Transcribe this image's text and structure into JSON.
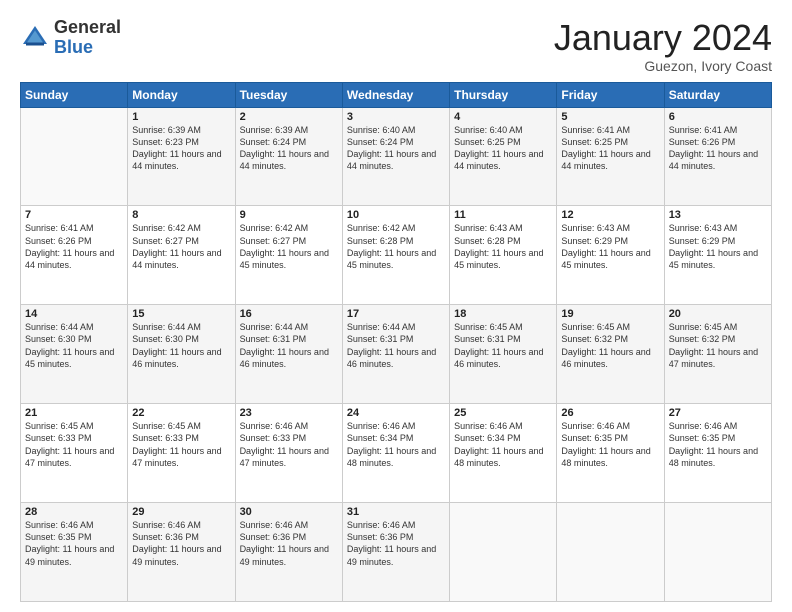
{
  "header": {
    "logo_general": "General",
    "logo_blue": "Blue",
    "month_title": "January 2024",
    "location": "Guezon, Ivory Coast"
  },
  "weekdays": [
    "Sunday",
    "Monday",
    "Tuesday",
    "Wednesday",
    "Thursday",
    "Friday",
    "Saturday"
  ],
  "weeks": [
    [
      {
        "day": "",
        "sunrise": "",
        "sunset": "",
        "daylight": ""
      },
      {
        "day": "1",
        "sunrise": "6:39 AM",
        "sunset": "6:23 PM",
        "daylight": "11 hours and 44 minutes."
      },
      {
        "day": "2",
        "sunrise": "6:39 AM",
        "sunset": "6:24 PM",
        "daylight": "11 hours and 44 minutes."
      },
      {
        "day": "3",
        "sunrise": "6:40 AM",
        "sunset": "6:24 PM",
        "daylight": "11 hours and 44 minutes."
      },
      {
        "day": "4",
        "sunrise": "6:40 AM",
        "sunset": "6:25 PM",
        "daylight": "11 hours and 44 minutes."
      },
      {
        "day": "5",
        "sunrise": "6:41 AM",
        "sunset": "6:25 PM",
        "daylight": "11 hours and 44 minutes."
      },
      {
        "day": "6",
        "sunrise": "6:41 AM",
        "sunset": "6:26 PM",
        "daylight": "11 hours and 44 minutes."
      }
    ],
    [
      {
        "day": "7",
        "sunrise": "6:41 AM",
        "sunset": "6:26 PM",
        "daylight": "11 hours and 44 minutes."
      },
      {
        "day": "8",
        "sunrise": "6:42 AM",
        "sunset": "6:27 PM",
        "daylight": "11 hours and 44 minutes."
      },
      {
        "day": "9",
        "sunrise": "6:42 AM",
        "sunset": "6:27 PM",
        "daylight": "11 hours and 45 minutes."
      },
      {
        "day": "10",
        "sunrise": "6:42 AM",
        "sunset": "6:28 PM",
        "daylight": "11 hours and 45 minutes."
      },
      {
        "day": "11",
        "sunrise": "6:43 AM",
        "sunset": "6:28 PM",
        "daylight": "11 hours and 45 minutes."
      },
      {
        "day": "12",
        "sunrise": "6:43 AM",
        "sunset": "6:29 PM",
        "daylight": "11 hours and 45 minutes."
      },
      {
        "day": "13",
        "sunrise": "6:43 AM",
        "sunset": "6:29 PM",
        "daylight": "11 hours and 45 minutes."
      }
    ],
    [
      {
        "day": "14",
        "sunrise": "6:44 AM",
        "sunset": "6:30 PM",
        "daylight": "11 hours and 45 minutes."
      },
      {
        "day": "15",
        "sunrise": "6:44 AM",
        "sunset": "6:30 PM",
        "daylight": "11 hours and 46 minutes."
      },
      {
        "day": "16",
        "sunrise": "6:44 AM",
        "sunset": "6:31 PM",
        "daylight": "11 hours and 46 minutes."
      },
      {
        "day": "17",
        "sunrise": "6:44 AM",
        "sunset": "6:31 PM",
        "daylight": "11 hours and 46 minutes."
      },
      {
        "day": "18",
        "sunrise": "6:45 AM",
        "sunset": "6:31 PM",
        "daylight": "11 hours and 46 minutes."
      },
      {
        "day": "19",
        "sunrise": "6:45 AM",
        "sunset": "6:32 PM",
        "daylight": "11 hours and 46 minutes."
      },
      {
        "day": "20",
        "sunrise": "6:45 AM",
        "sunset": "6:32 PM",
        "daylight": "11 hours and 47 minutes."
      }
    ],
    [
      {
        "day": "21",
        "sunrise": "6:45 AM",
        "sunset": "6:33 PM",
        "daylight": "11 hours and 47 minutes."
      },
      {
        "day": "22",
        "sunrise": "6:45 AM",
        "sunset": "6:33 PM",
        "daylight": "11 hours and 47 minutes."
      },
      {
        "day": "23",
        "sunrise": "6:46 AM",
        "sunset": "6:33 PM",
        "daylight": "11 hours and 47 minutes."
      },
      {
        "day": "24",
        "sunrise": "6:46 AM",
        "sunset": "6:34 PM",
        "daylight": "11 hours and 48 minutes."
      },
      {
        "day": "25",
        "sunrise": "6:46 AM",
        "sunset": "6:34 PM",
        "daylight": "11 hours and 48 minutes."
      },
      {
        "day": "26",
        "sunrise": "6:46 AM",
        "sunset": "6:35 PM",
        "daylight": "11 hours and 48 minutes."
      },
      {
        "day": "27",
        "sunrise": "6:46 AM",
        "sunset": "6:35 PM",
        "daylight": "11 hours and 48 minutes."
      }
    ],
    [
      {
        "day": "28",
        "sunrise": "6:46 AM",
        "sunset": "6:35 PM",
        "daylight": "11 hours and 49 minutes."
      },
      {
        "day": "29",
        "sunrise": "6:46 AM",
        "sunset": "6:36 PM",
        "daylight": "11 hours and 49 minutes."
      },
      {
        "day": "30",
        "sunrise": "6:46 AM",
        "sunset": "6:36 PM",
        "daylight": "11 hours and 49 minutes."
      },
      {
        "day": "31",
        "sunrise": "6:46 AM",
        "sunset": "6:36 PM",
        "daylight": "11 hours and 49 minutes."
      },
      {
        "day": "",
        "sunrise": "",
        "sunset": "",
        "daylight": ""
      },
      {
        "day": "",
        "sunrise": "",
        "sunset": "",
        "daylight": ""
      },
      {
        "day": "",
        "sunrise": "",
        "sunset": "",
        "daylight": ""
      }
    ]
  ],
  "labels": {
    "sunrise_prefix": "Sunrise: ",
    "sunset_prefix": "Sunset: ",
    "daylight_prefix": "Daylight: "
  }
}
